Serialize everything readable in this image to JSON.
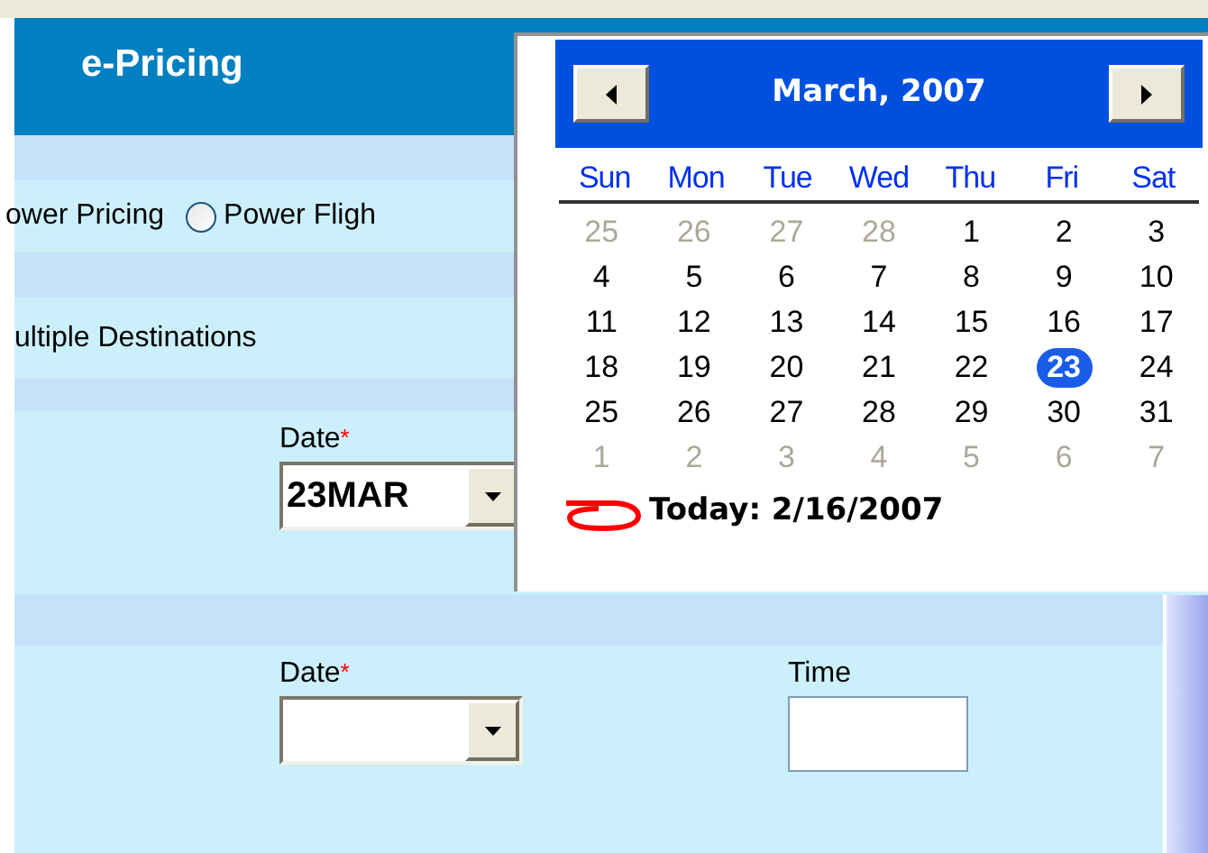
{
  "header": {
    "title": "e-Pricing"
  },
  "options_row": [
    {
      "kind": "text",
      "label": "ower Pricing"
    },
    {
      "kind": "radio",
      "label": "Power Fligh",
      "selected": false
    }
  ],
  "trip_option": {
    "label": "ultiple Destinations"
  },
  "segments": [
    {
      "date_label": "Date",
      "required_mark": "*",
      "date_value": "23MAR"
    },
    {
      "date_label": "Date",
      "required_mark": "*",
      "time_label": "Time"
    }
  ],
  "calendar": {
    "month_title": "March, 2007",
    "weekdays": [
      "Sun",
      "Mon",
      "Tue",
      "Wed",
      "Thu",
      "Fri",
      "Sat"
    ],
    "weeks": [
      [
        {
          "day": "25",
          "other_month": true,
          "selected": false
        },
        {
          "day": "26",
          "other_month": true,
          "selected": false
        },
        {
          "day": "27",
          "other_month": true,
          "selected": false
        },
        {
          "day": "28",
          "other_month": true,
          "selected": false
        },
        {
          "day": "1",
          "other_month": false,
          "selected": false
        },
        {
          "day": "2",
          "other_month": false,
          "selected": false
        },
        {
          "day": "3",
          "other_month": false,
          "selected": false
        }
      ],
      [
        {
          "day": "4",
          "other_month": false,
          "selected": false
        },
        {
          "day": "5",
          "other_month": false,
          "selected": false
        },
        {
          "day": "6",
          "other_month": false,
          "selected": false
        },
        {
          "day": "7",
          "other_month": false,
          "selected": false
        },
        {
          "day": "8",
          "other_month": false,
          "selected": false
        },
        {
          "day": "9",
          "other_month": false,
          "selected": false
        },
        {
          "day": "10",
          "other_month": false,
          "selected": false
        }
      ],
      [
        {
          "day": "11",
          "other_month": false,
          "selected": false
        },
        {
          "day": "12",
          "other_month": false,
          "selected": false
        },
        {
          "day": "13",
          "other_month": false,
          "selected": false
        },
        {
          "day": "14",
          "other_month": false,
          "selected": false
        },
        {
          "day": "15",
          "other_month": false,
          "selected": false
        },
        {
          "day": "16",
          "other_month": false,
          "selected": false
        },
        {
          "day": "17",
          "other_month": false,
          "selected": false
        }
      ],
      [
        {
          "day": "18",
          "other_month": false,
          "selected": false
        },
        {
          "day": "19",
          "other_month": false,
          "selected": false
        },
        {
          "day": "20",
          "other_month": false,
          "selected": false
        },
        {
          "day": "21",
          "other_month": false,
          "selected": false
        },
        {
          "day": "22",
          "other_month": false,
          "selected": false
        },
        {
          "day": "23",
          "other_month": false,
          "selected": true
        },
        {
          "day": "24",
          "other_month": false,
          "selected": false
        }
      ],
      [
        {
          "day": "25",
          "other_month": false,
          "selected": false
        },
        {
          "day": "26",
          "other_month": false,
          "selected": false
        },
        {
          "day": "27",
          "other_month": false,
          "selected": false
        },
        {
          "day": "28",
          "other_month": false,
          "selected": false
        },
        {
          "day": "29",
          "other_month": false,
          "selected": false
        },
        {
          "day": "30",
          "other_month": false,
          "selected": false
        },
        {
          "day": "31",
          "other_month": false,
          "selected": false
        }
      ],
      [
        {
          "day": "1",
          "other_month": true,
          "selected": false
        },
        {
          "day": "2",
          "other_month": true,
          "selected": false
        },
        {
          "day": "3",
          "other_month": true,
          "selected": false
        },
        {
          "day": "4",
          "other_month": true,
          "selected": false
        },
        {
          "day": "5",
          "other_month": true,
          "selected": false
        },
        {
          "day": "6",
          "other_month": true,
          "selected": false
        },
        {
          "day": "7",
          "other_month": true,
          "selected": false
        }
      ]
    ],
    "today": "Today: 2/16/2007"
  }
}
